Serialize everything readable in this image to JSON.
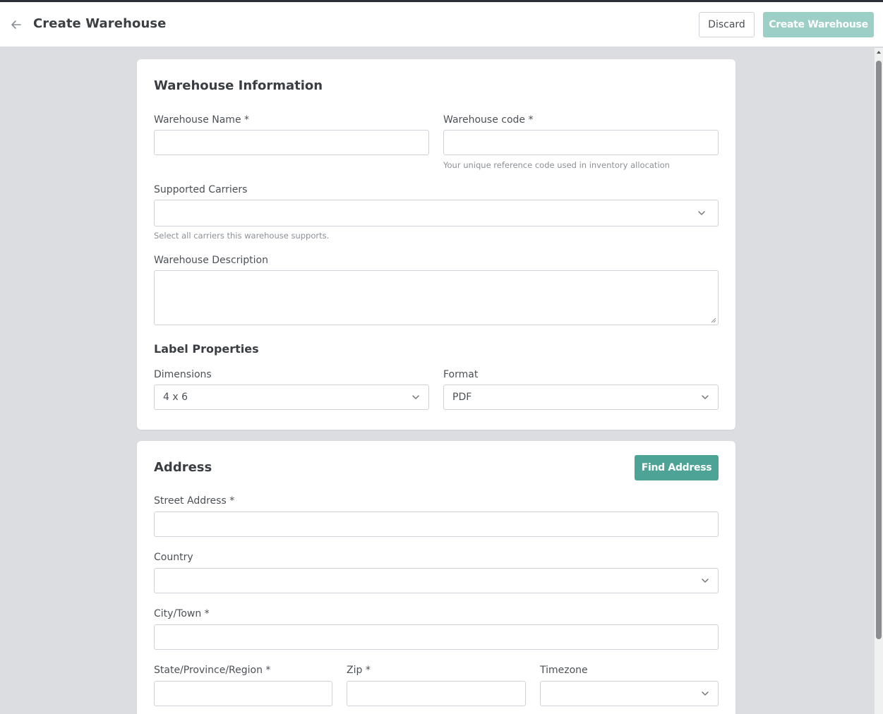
{
  "header": {
    "title": "Create Warehouse",
    "discard_label": "Discard",
    "create_label": "Create Warehouse"
  },
  "warehouse_info": {
    "title": "Warehouse Information",
    "name_label": "Warehouse Name *",
    "code_label": "Warehouse code *",
    "code_help": "Your unique reference code used in inventory allocation",
    "carriers_label": "Supported Carriers",
    "carriers_help": "Select all carriers this warehouse supports.",
    "description_label": "Warehouse Description"
  },
  "label_properties": {
    "title": "Label Properties",
    "dimensions_label": "Dimensions",
    "dimensions_value": "4 x 6",
    "format_label": "Format",
    "format_value": "PDF"
  },
  "address": {
    "title": "Address",
    "find_label": "Find Address",
    "street_label": "Street Address *",
    "country_label": "Country",
    "city_label": "City/Town *",
    "state_label": "State/Province/Region *",
    "zip_label": "Zip *",
    "timezone_label": "Timezone"
  },
  "colors": {
    "accent": "#4ea397",
    "accent_disabled": "#9ccfc6",
    "background": "#dcdde0"
  }
}
